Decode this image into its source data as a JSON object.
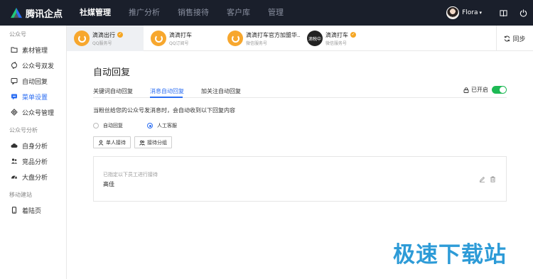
{
  "brand": {
    "name": "腾讯企点"
  },
  "nav": {
    "items": [
      {
        "label": "社媒管理",
        "active": true
      },
      {
        "label": "推广分析",
        "active": false
      },
      {
        "label": "销售接待",
        "active": false
      },
      {
        "label": "客户库",
        "active": false
      },
      {
        "label": "管理",
        "active": false
      }
    ]
  },
  "user": {
    "name": "Flora",
    "caret": "▾"
  },
  "sidebar": {
    "groups": [
      {
        "title": "公众号",
        "items": [
          {
            "label": "素材管理",
            "icon": "folder-icon",
            "active": false
          },
          {
            "label": "公众号双发",
            "icon": "refresh-send-icon",
            "active": false
          },
          {
            "label": "自动回复",
            "icon": "reply-icon",
            "active": false
          },
          {
            "label": "菜单设置",
            "icon": "menu-chat-icon",
            "active": true
          },
          {
            "label": "公众号管理",
            "icon": "settings-icon",
            "active": false
          }
        ]
      },
      {
        "title": "公众号分析",
        "items": [
          {
            "label": "自身分析",
            "icon": "cloud-icon",
            "active": false
          },
          {
            "label": "竞品分析",
            "icon": "people-icon",
            "active": false
          },
          {
            "label": "大盘分析",
            "icon": "dashboard-icon",
            "active": false
          }
        ]
      },
      {
        "title": "移动建站",
        "items": [
          {
            "label": "着陆页",
            "icon": "mobile-icon",
            "active": false
          }
        ]
      }
    ]
  },
  "accounts": {
    "items": [
      {
        "name": "滴滴出行",
        "type": "QQ服务号",
        "verified": true,
        "selected": true,
        "avatar": "didi-logo",
        "avatar_text": ""
      },
      {
        "name": "滴滴打车",
        "type": "QQ订阅号",
        "verified": false,
        "selected": false,
        "avatar": "didi-logo",
        "avatar_text": ""
      },
      {
        "name": "滴滴打车官方加盟华...",
        "type": "微信服务号",
        "verified": true,
        "selected": false,
        "avatar": "didi-logo",
        "avatar_text": ""
      },
      {
        "name": "滴滴打车",
        "type": "微信服务号",
        "verified": true,
        "selected": false,
        "avatar": "dark-logo",
        "avatar_text": "滴税中"
      }
    ],
    "sync_label": "同步"
  },
  "main": {
    "title": "自动回复",
    "tabs": [
      {
        "label": "关键词自动回复",
        "active": false
      },
      {
        "label": "消息自动回复",
        "active": true
      },
      {
        "label": "加关注自动回复",
        "active": false
      }
    ],
    "toggle": {
      "label": "已开启",
      "on": true
    },
    "description": "当粉丝给您的公众号发消息时，会自动收到以下回复内容",
    "radios": [
      {
        "label": "自动回复",
        "checked": false
      },
      {
        "label": "人工客服",
        "checked": true
      }
    ],
    "buttons": [
      {
        "label": "单人接待",
        "icon": "person-icon"
      },
      {
        "label": "接待分组",
        "icon": "group-icon"
      }
    ],
    "card": {
      "hint": "已指定以下员工进行接待",
      "name": "高佳"
    }
  },
  "watermark": {
    "text": "极速下载站",
    "color": "#2d9bd7"
  },
  "colors": {
    "accent": "#2c6ef2",
    "topbar": "#1a1f2b",
    "toggle_on": "#1db954",
    "verified": "#f5a623"
  }
}
